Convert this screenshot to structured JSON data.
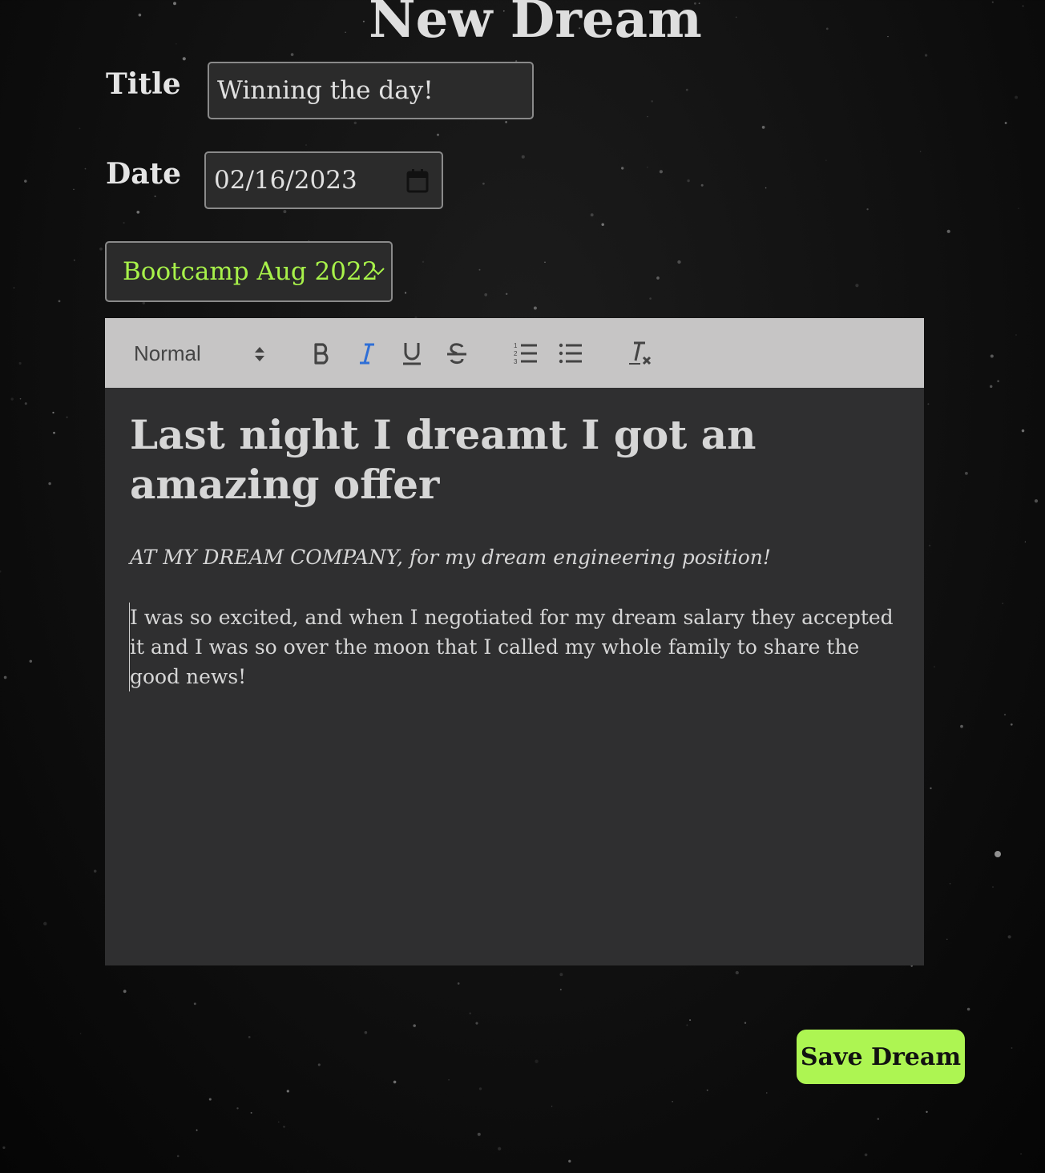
{
  "page": {
    "title": "New Dream"
  },
  "form": {
    "title_label": "Title",
    "title_value": "Winning the day!",
    "date_label": "Date",
    "date_value": "02/16/2023",
    "group_selected": "Bootcamp Aug 2022"
  },
  "toolbar": {
    "heading_value": "Normal",
    "buttons": [
      {
        "icon": "bold-icon",
        "active": false
      },
      {
        "icon": "italic-icon",
        "active": true
      },
      {
        "icon": "underline-icon",
        "active": false
      },
      {
        "icon": "strikethrough-icon",
        "active": false
      },
      {
        "icon": "ordered-list-icon",
        "active": false
      },
      {
        "icon": "bullet-list-icon",
        "active": false
      },
      {
        "icon": "clear-format-icon",
        "active": false
      }
    ],
    "active_color": "#2f6fd6",
    "icon_color": "#444444"
  },
  "editor": {
    "heading": "Last night I dreamt I got an amazing offer",
    "italic_line": "AT MY DREAM COMPANY, for my dream engineering position!",
    "paragraph": "I was so excited, and when I negotiated for my dream salary they accepted it and I was so over the moon that I called my whole family to share the good news!"
  },
  "actions": {
    "save_label": "Save Dream"
  },
  "colors": {
    "accent_green": "#adf552",
    "select_text_green": "#a8f24a",
    "input_bg": "#2b2b2b",
    "editor_bg": "#2f2f30",
    "toolbar_bg": "#c6c5c5"
  }
}
